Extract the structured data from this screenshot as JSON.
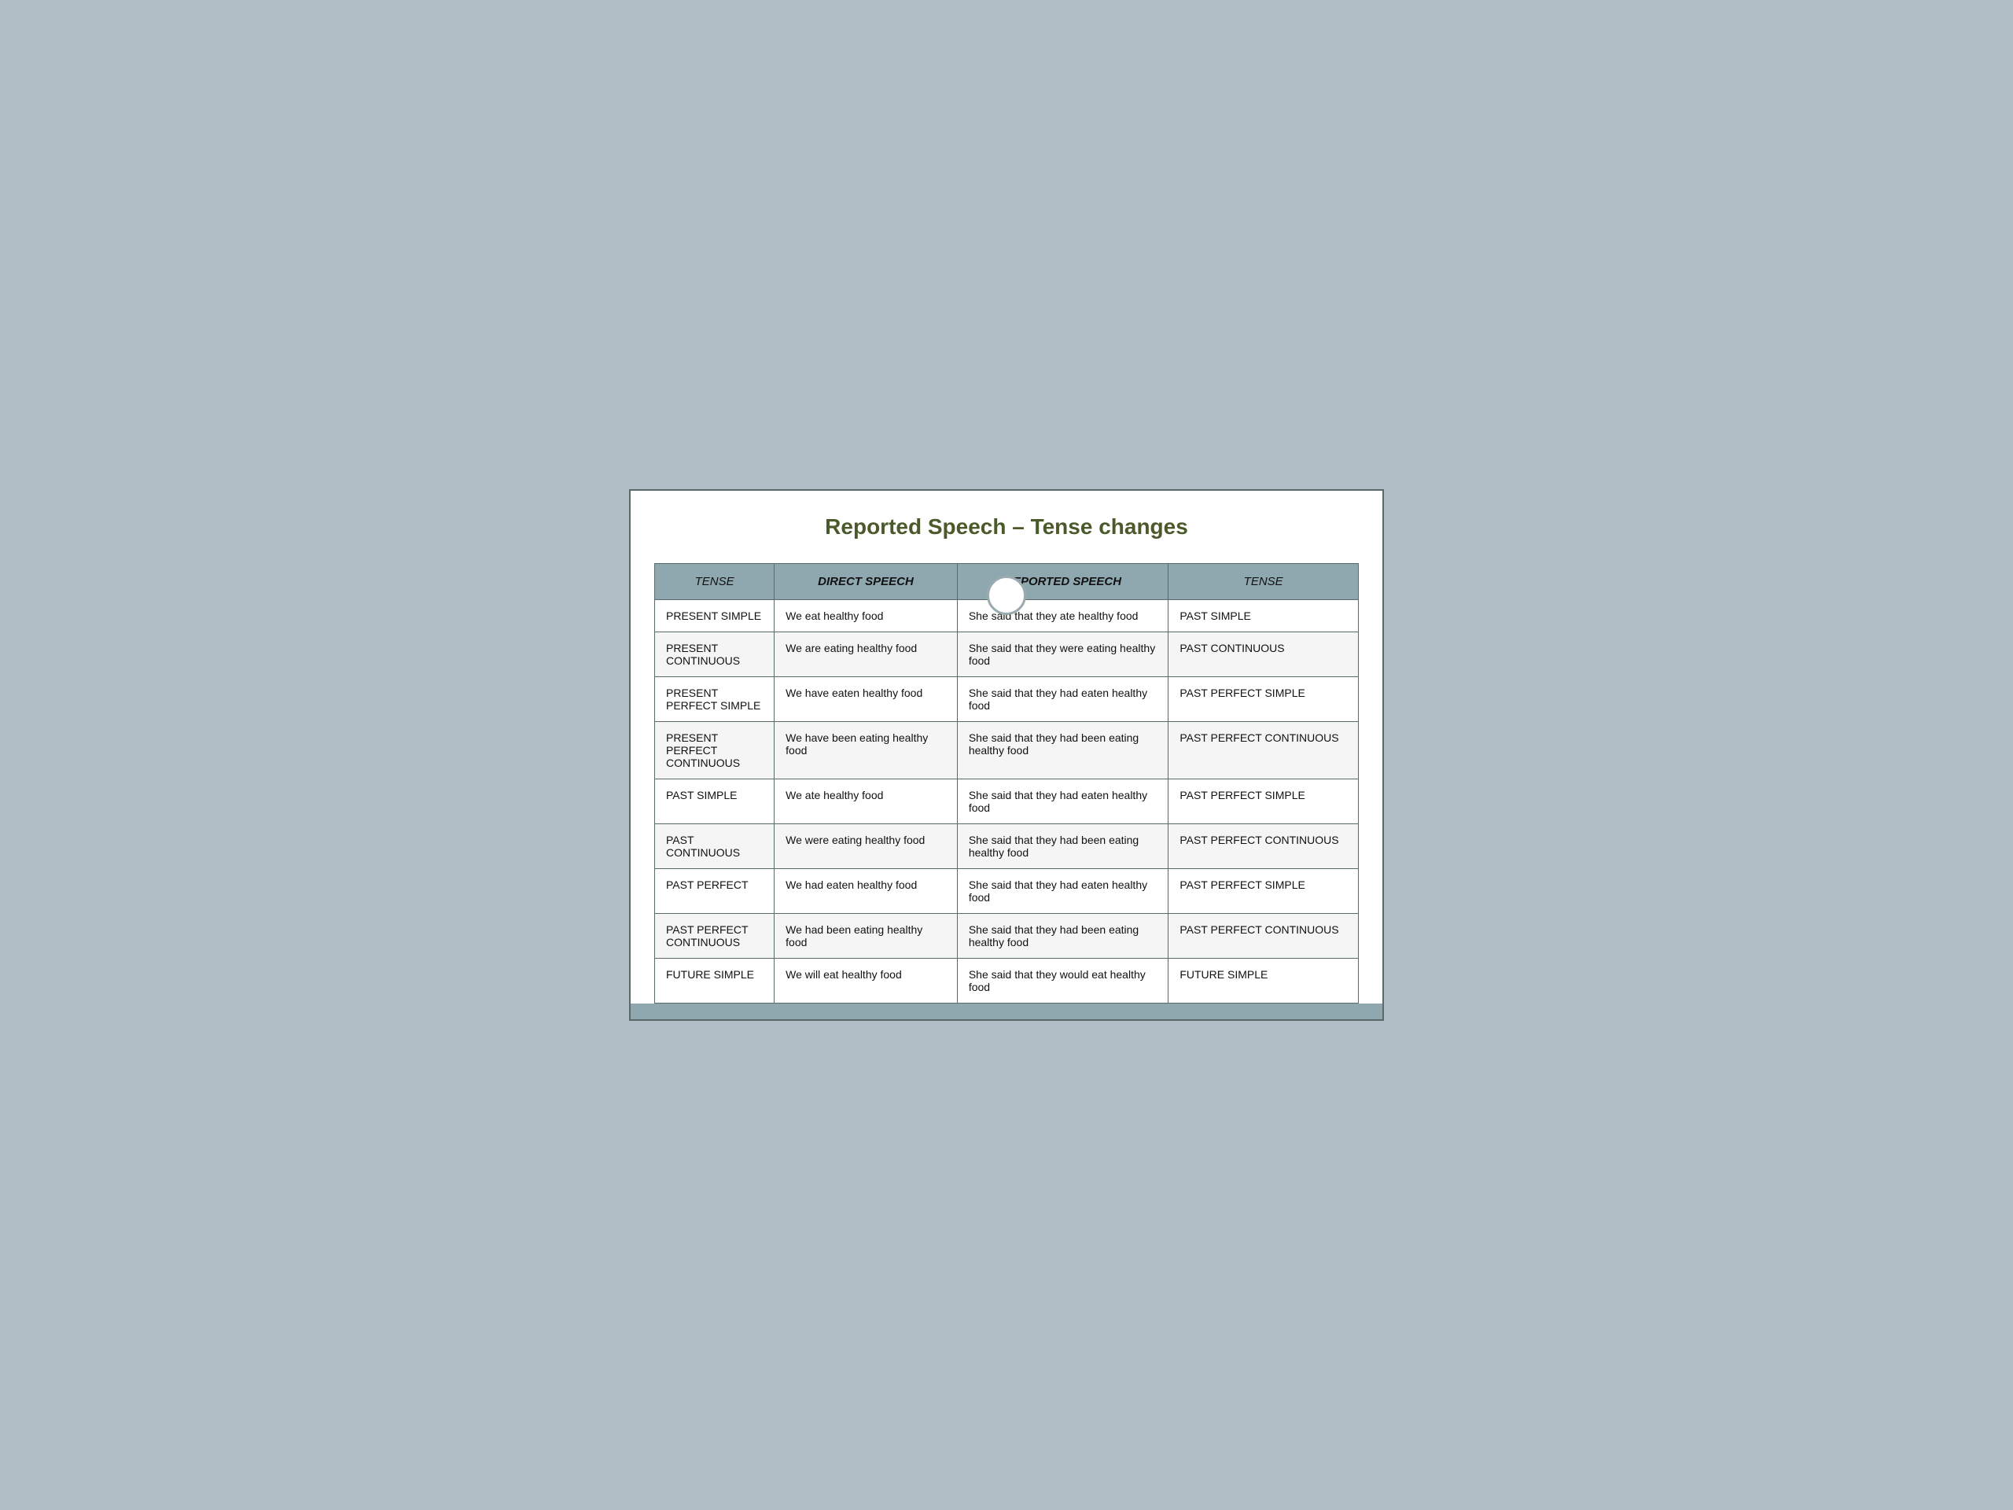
{
  "title": "Reported Speech – Tense changes",
  "headers": {
    "tense_left": "TENSE",
    "direct_speech": "DIRECT SPEECH",
    "reported_speech": "REPORTED SPEECH",
    "tense_right": "TENSE"
  },
  "rows": [
    {
      "tense_left": "PRESENT SIMPLE",
      "direct_speech": "We eat healthy food",
      "reported_speech": "She said that they ate healthy food",
      "tense_right": "PAST SIMPLE"
    },
    {
      "tense_left": "PRESENT CONTINUOUS",
      "direct_speech": "We are eating healthy food",
      "reported_speech": "She said that they were eating healthy food",
      "tense_right": "PAST CONTINUOUS"
    },
    {
      "tense_left": "PRESENT PERFECT SIMPLE",
      "direct_speech": "We have eaten healthy food",
      "reported_speech": "She said that they had eaten healthy food",
      "tense_right": "PAST PERFECT SIMPLE"
    },
    {
      "tense_left": "PRESENT PERFECT CONTINUOUS",
      "direct_speech": "We have been eating healthy food",
      "reported_speech": "She said that they had been eating  healthy food",
      "tense_right": "PAST PERFECT CONTINUOUS"
    },
    {
      "tense_left": "PAST SIMPLE",
      "direct_speech": "We ate healthy food",
      "reported_speech": "She said that they had eaten healthy food",
      "tense_right": "PAST PERFECT SIMPLE"
    },
    {
      "tense_left": "PAST CONTINUOUS",
      "direct_speech": "We were eating healthy food",
      "reported_speech": "She said that they had been eating healthy food",
      "tense_right": "PAST PERFECT CONTINUOUS"
    },
    {
      "tense_left": "PAST PERFECT",
      "direct_speech": "We had eaten healthy food",
      "reported_speech": "She said that they had eaten healthy food",
      "tense_right": "PAST PERFECT SIMPLE"
    },
    {
      "tense_left": "PAST PERFECT CONTINUOUS",
      "direct_speech": "We had been eating healthy food",
      "reported_speech": "She said that they had been eating  healthy food",
      "tense_right": "PAST PERFECT CONTINUOUS"
    },
    {
      "tense_left": "FUTURE SIMPLE",
      "direct_speech": "We will eat healthy food",
      "reported_speech": "She said that they would eat healthy food",
      "tense_right": "FUTURE SIMPLE"
    }
  ]
}
